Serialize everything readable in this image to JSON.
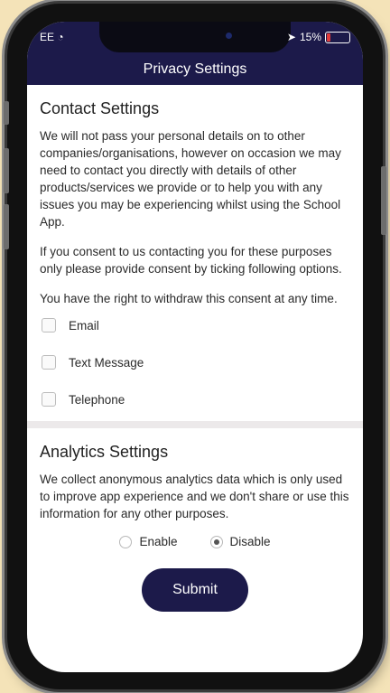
{
  "status_bar": {
    "carrier": "EE",
    "signal_icon": "wifi-icon",
    "location_icon": "location-arrow-icon",
    "battery_text": "15%",
    "battery_level": 0.15
  },
  "header": {
    "title": "Privacy Settings"
  },
  "contact": {
    "heading": "Contact Settings",
    "paragraph1": "We will not pass your personal details on to other companies/organisations, however on occasion we may need to contact you directly with details of other products/services we provide or to help you with any issues you may be experiencing whilst using the School App.",
    "paragraph2": "If you consent to us contacting you for these purposes only please provide consent by ticking following options.",
    "paragraph3": "You have the right to withdraw this consent at any time.",
    "options": [
      {
        "label": "Email",
        "checked": false
      },
      {
        "label": "Text Message",
        "checked": false
      },
      {
        "label": "Telephone",
        "checked": false
      }
    ]
  },
  "analytics": {
    "heading": "Analytics Settings",
    "paragraph": "We collect anonymous analytics data which is only used to improve app experience and we don't share or use this information for any other purposes.",
    "enable_label": "Enable",
    "disable_label": "Disable",
    "selected": "Disable"
  },
  "submit_label": "Submit",
  "colors": {
    "header_bg": "#1c1a4a",
    "button_bg": "#1c1a4a",
    "background": "#f4e3b8"
  }
}
